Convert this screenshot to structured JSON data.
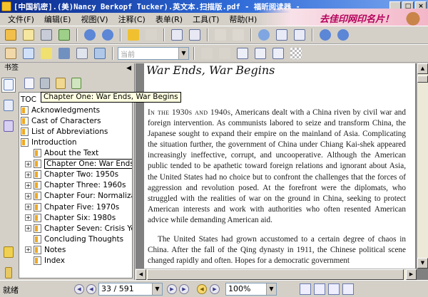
{
  "window": {
    "title": "[中国机密].(美)Nancy Berkopf Tucker).英文本.扫描版.pdf - 福昕阅读器 - [[中国机密].(美)Nanc..."
  },
  "banner": {
    "text": "去佳印网印名片！"
  },
  "menu": [
    "文件(F)",
    "编辑(E)",
    "视图(V)",
    "注释(C)",
    "表单(R)",
    "工具(T)",
    "帮助(H)"
  ],
  "toolbar2": {
    "combo_value": "当前"
  },
  "sidebar": {
    "title": "书签",
    "tooltip": "Chapter One: War Ends, War Begins",
    "bookmarks": [
      {
        "label": "TOC",
        "level": 0,
        "expander": "",
        "icon": false
      },
      {
        "label": "Acknowledgments",
        "level": 1,
        "expander": "",
        "icon": true
      },
      {
        "label": "Cast of Characters",
        "level": 1,
        "expander": "",
        "icon": true
      },
      {
        "label": "List of Abbreviations",
        "level": 1,
        "expander": "",
        "icon": true
      },
      {
        "label": "Introduction",
        "level": 1,
        "expander": "",
        "icon": true
      },
      {
        "label": "About the Text",
        "level": 2,
        "expander": "",
        "icon": true
      },
      {
        "label": "Chapter One: War Ends, War Begins",
        "level": 2,
        "expander": "+",
        "icon": true,
        "selected": true
      },
      {
        "label": "Chapter Two: 1950s",
        "level": 2,
        "expander": "+",
        "icon": true
      },
      {
        "label": "Chapter Three: 1960s",
        "level": 2,
        "expander": "+",
        "icon": true
      },
      {
        "label": "Chapter Four: Normalizat",
        "level": 2,
        "expander": "+",
        "icon": true
      },
      {
        "label": "Chpater Five: 1970s",
        "level": 2,
        "expander": "+",
        "icon": true
      },
      {
        "label": "Chapter Six: 1980s",
        "level": 2,
        "expander": "+",
        "icon": true
      },
      {
        "label": "Chapter Seven: Crisis Yea",
        "level": 2,
        "expander": "+",
        "icon": true
      },
      {
        "label": "Concluding Thoughts",
        "level": 2,
        "expander": "",
        "icon": true
      },
      {
        "label": "Notes",
        "level": 2,
        "expander": "+",
        "icon": true
      },
      {
        "label": "Index",
        "level": 2,
        "expander": "",
        "icon": true
      }
    ]
  },
  "document": {
    "chapter_title": "War Ends, War Begins",
    "paragraph1_lead": "In the 1930s and 1940s,",
    "paragraph1": " Americans dealt with a China riven by civil war and foreign intervention. As communists labored to seize and transform China, the Japanese sought to expand their empire on the mainland of Asia. Complicating the situation further, the government of China under Chiang Kai-shek appeared increasingly ineffective, corrupt, and uncooperative. Although the American public tended to be apathetic toward foreign relations and ignorant about Asia, the United States had no choice but to confront the challenges that the forces of aggression and revolution posed. At the forefront were the diplomats, who struggled with the realities of war on the ground in China, seeking to protect American interests and work with authorities who often resented American advice while demanding American aid.",
    "paragraph2": "The United States had grown accustomed to a certain degree of chaos in China. After the fall of the Qing dynasty in 1911, the Chinese political scene changed rapidly and often. Hopes for a democratic government"
  },
  "status": {
    "ready": "就绪",
    "page": "33 / 591",
    "zoom": "100%"
  }
}
